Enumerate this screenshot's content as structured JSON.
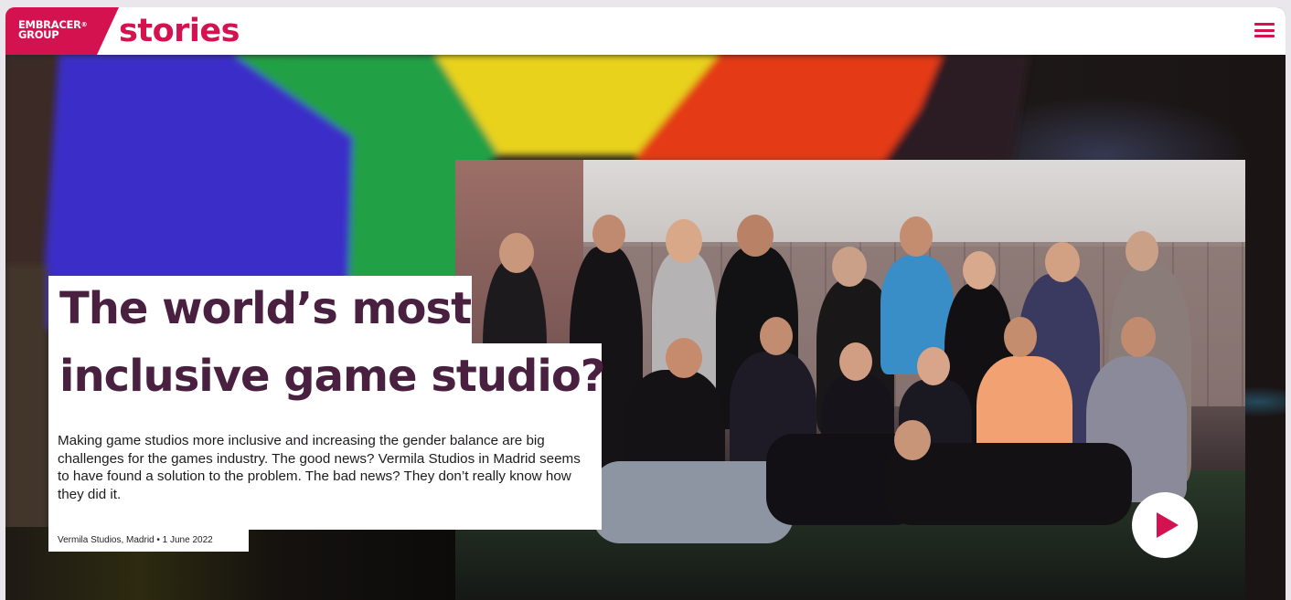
{
  "header": {
    "logo_line1": "EMBRACER",
    "logo_reg": "®",
    "logo_line2": "GROUP",
    "brand_word": "stories",
    "menu_icon": "hamburger-menu-icon"
  },
  "article": {
    "title_line1": "The world’s most",
    "title_line2": "inclusive game studio?",
    "summary": "Making game studios more inclusive and increasing the gender balance are big challenges for the games industry. The good news? Vermila Studios in Madrid seems to have found a solution to the problem. The bad news? They don’t really know how they did it.",
    "meta": "Vermila Studios, Madrid • 1 June 2022"
  },
  "video": {
    "play_icon": "play-icon"
  },
  "colors": {
    "brand": "#d3124f",
    "title": "#4a2040",
    "header_bg": "#ffffff"
  }
}
